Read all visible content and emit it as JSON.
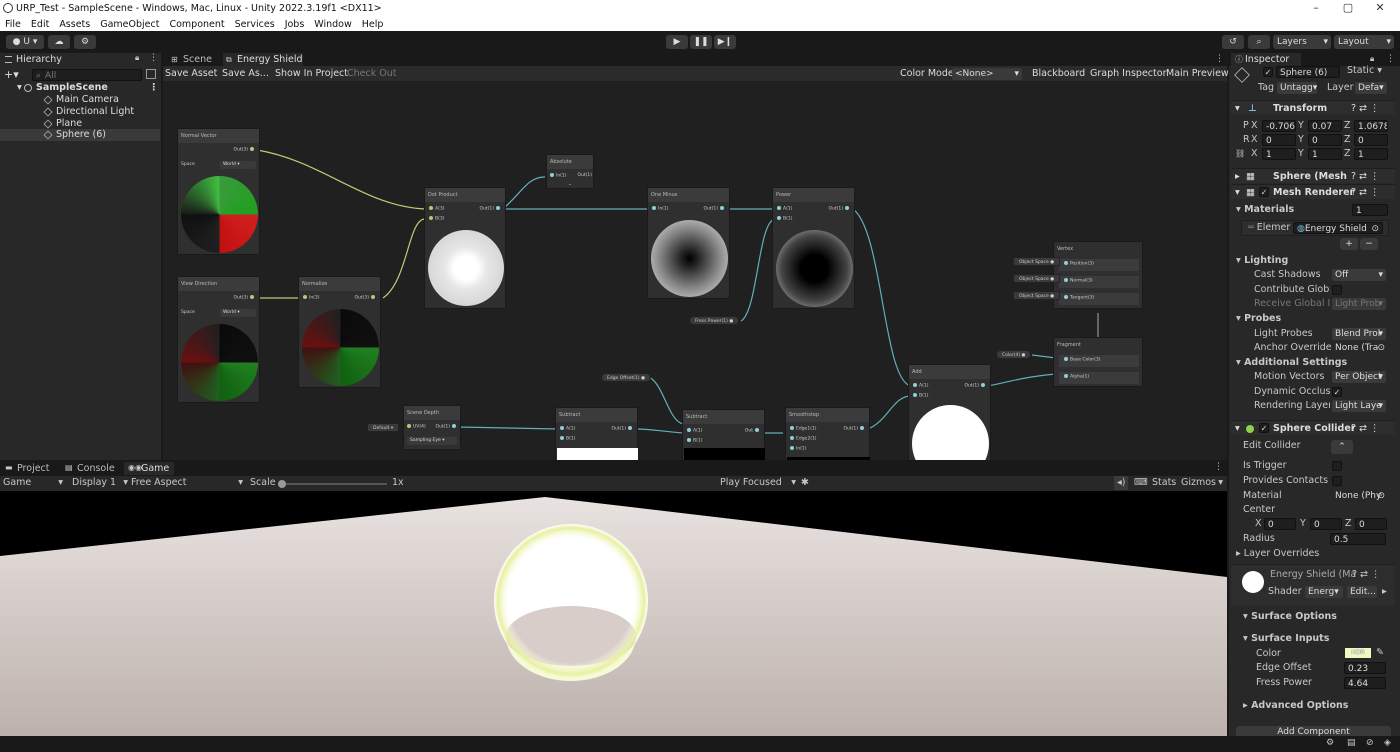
{
  "window": {
    "title": "URP_Test - SampleScene - Windows, Mac, Linux - Unity 2022.3.19f1 <DX11>"
  },
  "menu": [
    "File",
    "Edit",
    "Assets",
    "GameObject",
    "Component",
    "Services",
    "Jobs",
    "Window",
    "Help"
  ],
  "toolbar": {
    "account": "U",
    "layers": "Layers",
    "layout": "Layout"
  },
  "hierarchy": {
    "tab": "Hierarchy",
    "search_placeholder": "All",
    "scene": "SampleScene",
    "items": [
      "Main Camera",
      "Directional Light",
      "Plane",
      "Sphere (6)"
    ]
  },
  "graph": {
    "tabs": [
      "Scene",
      "Energy Shield"
    ],
    "save_asset": "Save Asset",
    "save_as": "Save As...",
    "show_in_project": "Show In Project",
    "check_out": "Check Out",
    "color_mode_label": "Color Mode",
    "color_mode_value": "<None>",
    "blackboard": "Blackboard",
    "graph_inspector": "Graph Inspector",
    "main_preview": "Main Preview",
    "nodes": {
      "normal_vector": {
        "title": "Normal Vector",
        "out": "Out(3)",
        "space_label": "Space",
        "space_value": "World"
      },
      "view_direction": {
        "title": "View Direction",
        "out": "Out(3)",
        "space_label": "Space",
        "space_value": "World"
      },
      "normalize": {
        "title": "Normalize",
        "in": "In(3)",
        "out": "Out(3)"
      },
      "dot_product": {
        "title": "Dot Product",
        "a": "A(3)",
        "b": "B(3)",
        "out": "Out(1)"
      },
      "absolute": {
        "title": "Absolute",
        "in": "In(1)",
        "out": "Out(1)"
      },
      "one_minus": {
        "title": "One Minus",
        "in": "In(1)",
        "out": "Out(1)"
      },
      "power": {
        "title": "Power",
        "a": "A(1)",
        "b": "B(1)",
        "out": "Out(1)"
      },
      "fress_power": "Fress Power(1)",
      "edge_offset": "Edge Offset(1)",
      "scene_depth": {
        "title": "Scene Depth",
        "uv": "UV(4)",
        "out": "Out(1)",
        "mode": "Default",
        "sampling": "Sampling Eye"
      },
      "subtract1": {
        "title": "Subtract",
        "a": "A(1)",
        "b": "B(1)",
        "out": "Out(1)"
      },
      "subtract2": {
        "title": "Subtract",
        "a": "A(1)",
        "b": "B(1)",
        "out": "Out"
      },
      "smoothstep": {
        "title": "Smoothstep",
        "e1": "Edge1(1)",
        "e2": "Edge2(1)",
        "in": "In(1)",
        "out": "Out(1)"
      },
      "add": {
        "title": "Add",
        "a": "A(1)",
        "b": "B(1)",
        "out": "Out(1)"
      },
      "vertex": {
        "title": "Vertex",
        "position": "Position(3)",
        "normal": "Normal(3)",
        "tangent": "Tangent(3)",
        "space": "Object Space"
      },
      "fragment": {
        "title": "Fragment",
        "base_color": "Base Color(3)",
        "alpha": "Alpha(1)",
        "color_pill": "Color(4)"
      }
    }
  },
  "bottom": {
    "tabs": [
      "Project",
      "Console",
      "Game"
    ],
    "game_dropdown": "Game",
    "display": "Display 1",
    "aspect": "Free Aspect",
    "scale_label": "Scale",
    "scale_value": "1x",
    "play_focused": "Play Focused",
    "stats": "Stats",
    "gizmos": "Gizmos"
  },
  "inspector": {
    "tab": "Inspector",
    "object_name": "Sphere (6)",
    "static": "Static",
    "tag_label": "Tag",
    "tag_value": "Untagg",
    "layer_label": "Layer",
    "layer_value": "Defa",
    "transform": {
      "title": "Transform",
      "p_label": "P",
      "r_label": "R",
      "position": {
        "x": "-0.706",
        "y": "0.07",
        "z": "1.0678"
      },
      "rotation": {
        "x": "0",
        "y": "0",
        "z": "0"
      },
      "scale": {
        "x": "1",
        "y": "1",
        "z": "1"
      }
    },
    "mesh_filter": "Sphere (Mesh Fi",
    "mesh_renderer": {
      "title": "Mesh Renderer",
      "materials_label": "Materials",
      "materials_count": "1",
      "element_label": "Elemer",
      "element_value": "Energy Shield",
      "lighting": "Lighting",
      "cast_shadows_label": "Cast Shadows",
      "cast_shadows_value": "Off",
      "contribute_gi": "Contribute Global I",
      "receive_gi": "Receive Global Illu",
      "receive_gi_value": "Light Prob",
      "probes": "Probes",
      "light_probes_label": "Light Probes",
      "light_probes_value": "Blend Prol",
      "anchor_label": "Anchor Override",
      "anchor_value": "None (Tra",
      "additional": "Additional Settings",
      "motion_label": "Motion Vectors",
      "motion_value": "Per Object",
      "dynamic_occ": "Dynamic Occlusio",
      "rendering_layer": "Rendering Layer M",
      "rendering_layer_value": "Light Laye"
    },
    "sphere_collider": {
      "title": "Sphere Collider",
      "edit_collider": "Edit Collider",
      "is_trigger": "Is Trigger",
      "provides_contacts": "Provides Contacts",
      "material_label": "Material",
      "material_value": "None (Phy",
      "center_label": "Center",
      "center": {
        "x": "0",
        "y": "0",
        "z": "0"
      },
      "radius_label": "Radius",
      "radius_value": "0.5",
      "layer_overrides": "Layer Overrides"
    },
    "material": {
      "name": "Energy Shield (Ma",
      "shader_label": "Shader",
      "shader_value": "Energ",
      "edit": "Edit...",
      "surface_options": "Surface Options",
      "surface_inputs": "Surface Inputs",
      "color_label": "Color",
      "color_hdr": "HDR",
      "edge_offset_label": "Edge Offset",
      "edge_offset_value": "0.23",
      "fress_power_label": "Fress Power",
      "fress_power_value": "4.64",
      "advanced": "Advanced Options"
    },
    "add_component": "Add Component"
  },
  "colors": {
    "accent": "#3a72b0",
    "node_wire_yellow": "#c8c878",
    "node_wire_cyan": "#5fb0b8",
    "shield_rim": "#e8f0a0"
  }
}
